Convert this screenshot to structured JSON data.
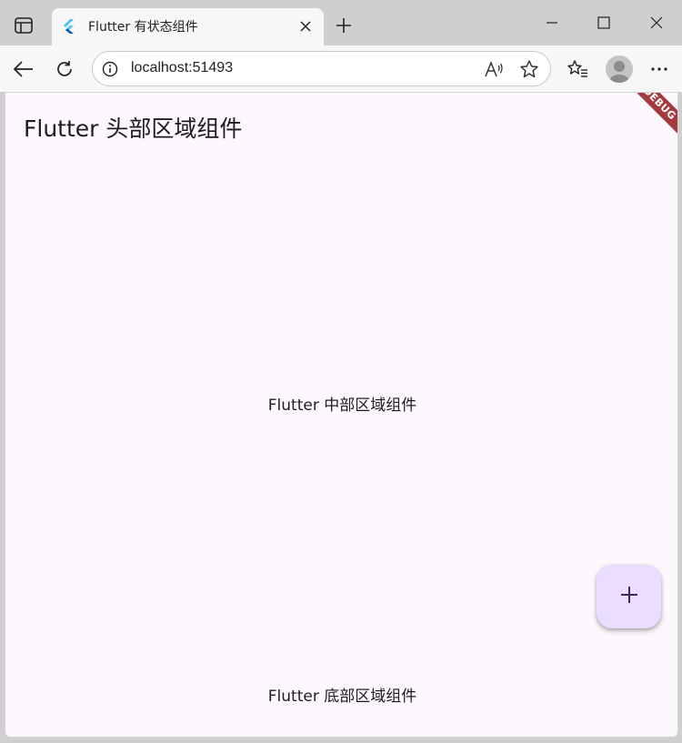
{
  "browser": {
    "tab": {
      "title": "Flutter 有状态组件",
      "favicon": "flutter-logo-icon"
    },
    "address": "localhost:51493",
    "icons": {
      "sidebar": "sidebar-icon",
      "close_tab": "close-icon",
      "new_tab": "plus-icon",
      "minimize": "minimize-icon",
      "maximize": "maximize-icon",
      "close_window": "close-icon",
      "back": "back-arrow-icon",
      "refresh": "refresh-icon",
      "info": "info-icon",
      "read_aloud": "read-aloud-icon",
      "favorite": "star-icon",
      "favorites": "favorites-list-icon",
      "profile": "avatar",
      "menu": "more-icon"
    }
  },
  "app": {
    "header_title": "Flutter 头部区域组件",
    "center_text": "Flutter 中部区域组件",
    "footer_text": "Flutter 底部区域组件",
    "debug_banner": "DEBUG",
    "fab_icon": "plus-icon"
  },
  "colors": {
    "background": "#fdf7fe",
    "fab": "#eaddff",
    "debug_banner": "#a33a3e",
    "text": "#1d1b20"
  }
}
